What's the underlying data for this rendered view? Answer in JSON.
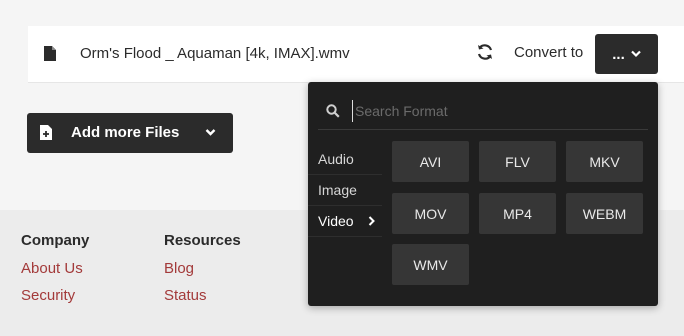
{
  "file": {
    "name": "Orm's Flood _ Aquaman [4k, IMAX].wmv",
    "convert_label": "Convert to",
    "format_button_label": "..."
  },
  "add_files": {
    "label": "Add more Files"
  },
  "footer": {
    "columns": [
      {
        "title": "Company",
        "links": [
          "About Us",
          "Security"
        ]
      },
      {
        "title": "Resources",
        "links": [
          "Blog",
          "Status"
        ]
      }
    ]
  },
  "dropdown": {
    "search_placeholder": "Search Format",
    "categories": [
      "Audio",
      "Image",
      "Video"
    ],
    "active_category": "Video",
    "formats": [
      "AVI",
      "FLV",
      "MKV",
      "MOV",
      "MP4",
      "WEBM",
      "WMV"
    ]
  },
  "colors": {
    "dark": "#2b2b2b",
    "link": "#a33a3a",
    "dropdown_bg": "#1f1f1f",
    "format_tile": "#363636"
  },
  "icons": [
    "file-icon",
    "refresh-icon",
    "chevron-down-icon",
    "file-plus-icon",
    "search-icon",
    "chevron-right-icon"
  ]
}
